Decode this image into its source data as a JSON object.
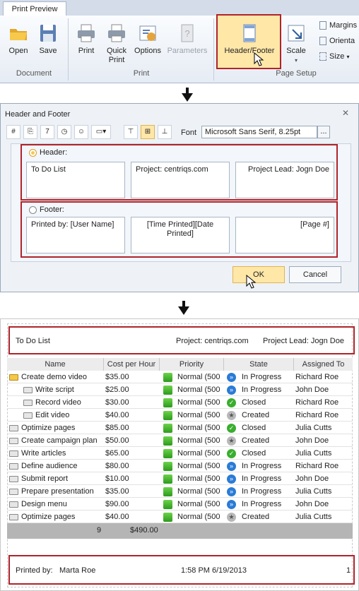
{
  "ribbon": {
    "tab": "Print Preview",
    "buttons": {
      "open": "Open",
      "save": "Save",
      "print": "Print",
      "quick_print": "Quick Print",
      "options": "Options",
      "parameters": "Parameters",
      "header_footer": "Header/Footer",
      "scale": "Scale",
      "margins": "Margins",
      "orientation": "Orienta",
      "size": "Size"
    },
    "groups": {
      "document": "Document",
      "print": "Print",
      "page_setup": "Page Setup"
    }
  },
  "dialog": {
    "title": "Header and Footer",
    "font_label": "Font",
    "font_value": "Microsoft Sans Serif, 8.25pt",
    "font_button": "...",
    "header_label": "Header:",
    "header_left": "To Do List",
    "header_center": "Project: centriqs.com",
    "header_right": "Project Lead: Jogn Doe",
    "footer_label": "Footer:",
    "footer_left": "Printed by: [User Name]",
    "footer_center": "[Time Printed][Date Printed]",
    "footer_right": "[Page #]",
    "ok": "OK",
    "cancel": "Cancel"
  },
  "preview": {
    "header_left": "To Do List",
    "header_center": "Project: centriqs.com",
    "header_right": "Project Lead: Jogn Doe",
    "columns": [
      "Name",
      "Cost per Hour",
      "Priority",
      "State",
      "Assigned To"
    ],
    "rows": [
      {
        "name": "Create demo video",
        "cost": "$35.00",
        "priority": "Normal (500",
        "state": "In Progress",
        "assigned": "Richard Roe",
        "indent": 0,
        "folder": "open",
        "state_icon": "progress"
      },
      {
        "name": "Write script",
        "cost": "$25.00",
        "priority": "Normal (500",
        "state": "In Progress",
        "assigned": "John Doe",
        "indent": 1,
        "folder": "closed",
        "state_icon": "progress"
      },
      {
        "name": "Record video",
        "cost": "$30.00",
        "priority": "Normal (500",
        "state": "Closed",
        "assigned": "Richard Roe",
        "indent": 1,
        "folder": "closed",
        "state_icon": "closed"
      },
      {
        "name": "Edit video",
        "cost": "$40.00",
        "priority": "Normal (500",
        "state": "Created",
        "assigned": "Richard Roe",
        "indent": 1,
        "folder": "closed",
        "state_icon": "created"
      },
      {
        "name": "Optimize pages",
        "cost": "$85.00",
        "priority": "Normal (500",
        "state": "Closed",
        "assigned": "Julia Cutts",
        "indent": 0,
        "folder": "closed",
        "state_icon": "closed"
      },
      {
        "name": "Create campaign plan",
        "cost": "$50.00",
        "priority": "Normal (500",
        "state": "Created",
        "assigned": "John Doe",
        "indent": 0,
        "folder": "closed",
        "state_icon": "created"
      },
      {
        "name": "Write articles",
        "cost": "$65.00",
        "priority": "Normal (500",
        "state": "Closed",
        "assigned": "Julia Cutts",
        "indent": 0,
        "folder": "closed",
        "state_icon": "closed"
      },
      {
        "name": "Define audience",
        "cost": "$80.00",
        "priority": "Normal (500",
        "state": "In Progress",
        "assigned": "Richard Roe",
        "indent": 0,
        "folder": "closed",
        "state_icon": "progress"
      },
      {
        "name": "Submit report",
        "cost": "$10.00",
        "priority": "Normal (500",
        "state": "In Progress",
        "assigned": "John Doe",
        "indent": 0,
        "folder": "closed",
        "state_icon": "progress"
      },
      {
        "name": "Prepare presentation",
        "cost": "$35.00",
        "priority": "Normal (500",
        "state": "In Progress",
        "assigned": "Julia Cutts",
        "indent": 0,
        "folder": "closed",
        "state_icon": "progress"
      },
      {
        "name": "Design menu",
        "cost": "$90.00",
        "priority": "Normal (500",
        "state": "In Progress",
        "assigned": "John Doe",
        "indent": 0,
        "folder": "closed",
        "state_icon": "progress"
      },
      {
        "name": "Optimize pages",
        "cost": "$40.00",
        "priority": "Normal (500",
        "state": "Created",
        "assigned": "Julia Cutts",
        "indent": 0,
        "folder": "closed",
        "state_icon": "created"
      }
    ],
    "summary_count": "9",
    "summary_cost": "$490.00",
    "footer_printed_by": "Printed by:",
    "footer_user": "Marta Roe",
    "footer_time": "1:58 PM",
    "footer_date": "6/19/2013",
    "footer_page": "1"
  }
}
